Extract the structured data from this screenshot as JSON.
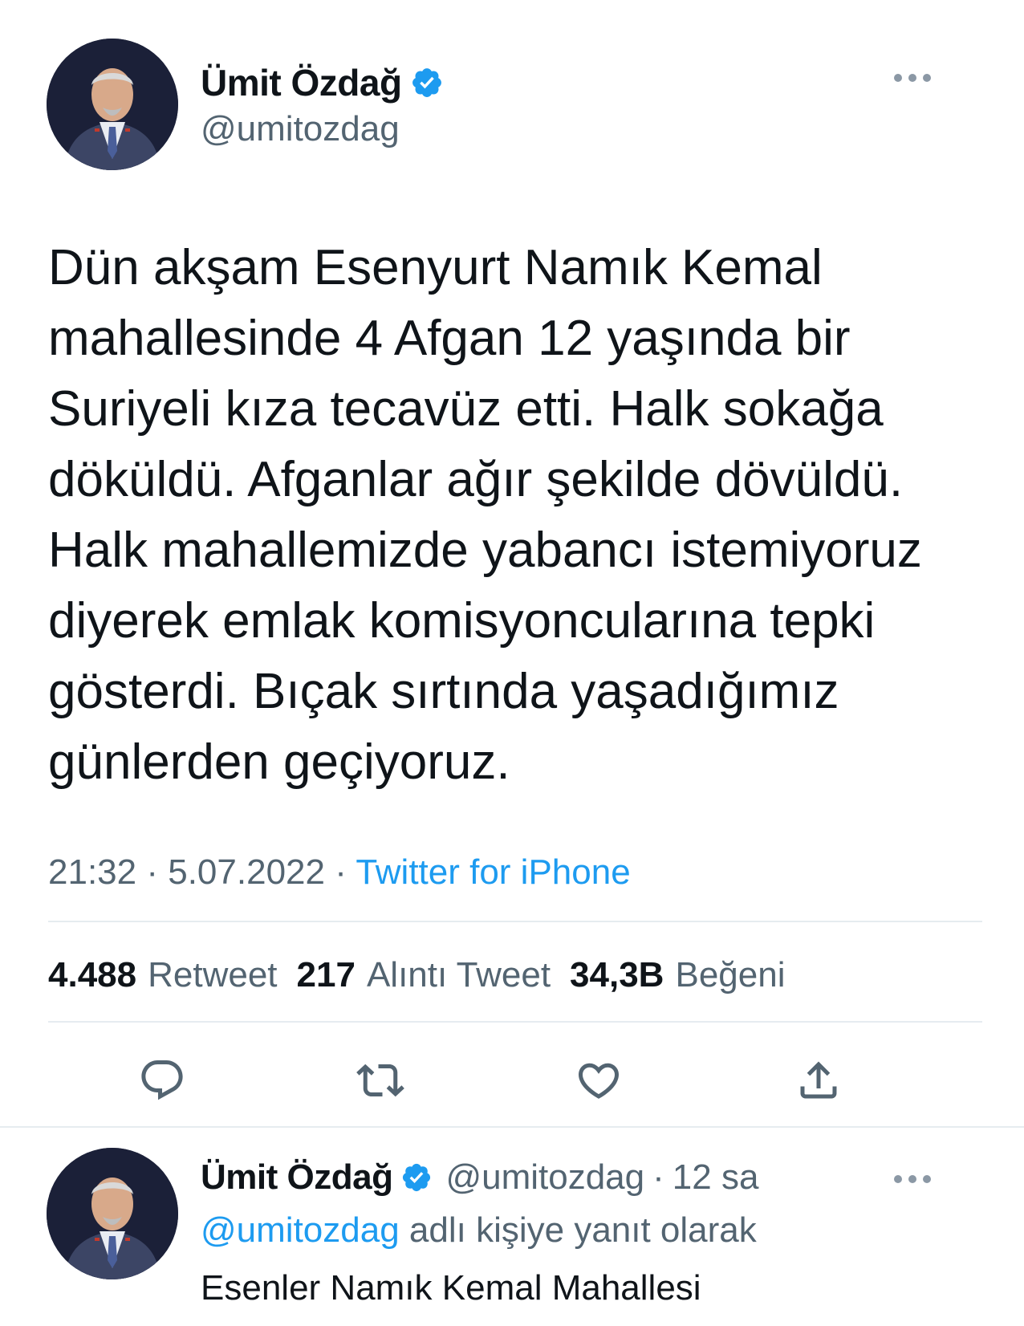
{
  "tweet": {
    "author_name": "Ümit Özdağ",
    "author_handle": "@umitozdag",
    "text": "Dün akşam Esenyurt Namık Kemal\nmahallesinde 4 Afgan 12 yaşında bir\nSuriyeli kıza tecavüz etti. Halk sokağa\ndöküldü. Afganlar ağır şekilde dövüldü.\nHalk mahallemizde yabancı istemiyoruz\ndiyerek emlak komisyoncularına tepki\ngösterdi. Bıçak sırtında yaşadığımız\ngünlerden geçiyoruz.",
    "time": "21:32",
    "date": "5.07.2022",
    "separator": "·",
    "source": "Twitter for iPhone",
    "stats": {
      "retweets": "4.488",
      "retweets_label": "Retweet",
      "quotes": "217",
      "quotes_label": "Alıntı Tweet",
      "likes": "34,3B",
      "likes_label": "Beğeni"
    },
    "actions": [
      "reply-icon",
      "retweet-icon",
      "like-icon",
      "share-icon"
    ]
  },
  "reply": {
    "author_name": "Ümit Özdağ",
    "author_handle": "@umitozdag",
    "separator": "·",
    "age": "12 sa",
    "replying_to": "@umitozdag",
    "replying_suffix": "adlı kişiye yanıt olarak",
    "text": "Esenler Namık Kemal Mahallesi"
  },
  "colors": {
    "accent": "#1d9bf0",
    "secondary_text": "#536471",
    "primary_text": "#0f1419",
    "divider": "#e6ecf0"
  }
}
